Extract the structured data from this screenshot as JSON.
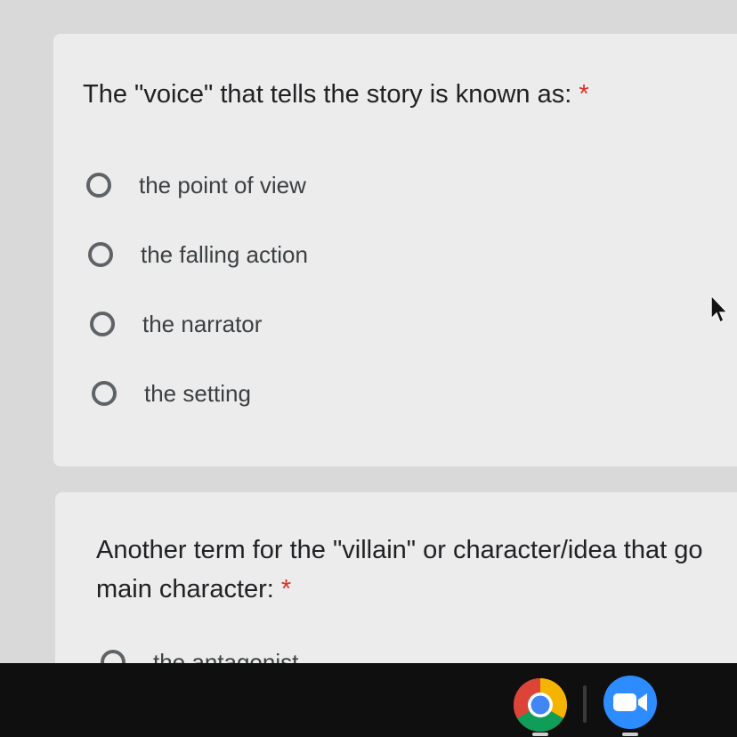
{
  "question1": {
    "title": "The \"voice\" that tells the story is known as:",
    "required_marker": "*",
    "options": [
      "the point of view",
      "the falling action",
      "the narrator",
      "the setting"
    ]
  },
  "question2": {
    "title_line1": "Another term for the \"villain\" or character/idea that go",
    "title_line2": "main character:",
    "required_marker": "*",
    "partial_option": "the antagonist"
  },
  "taskbar": {
    "icons": [
      "chrome-icon",
      "zoom-icon"
    ]
  }
}
